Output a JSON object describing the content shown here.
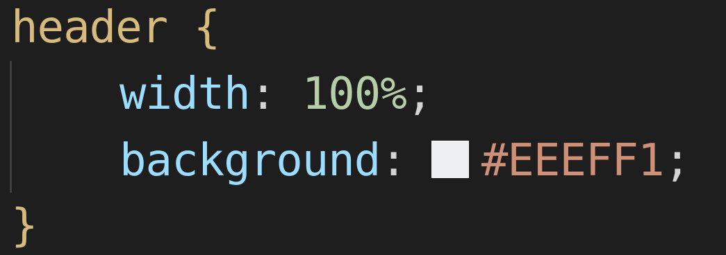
{
  "code": {
    "line1": {
      "selector": "header",
      "open_brace": "{"
    },
    "line2": {
      "property": "width",
      "colon": ":",
      "value": "100%",
      "semicolon": ";"
    },
    "line3": {
      "property": "background",
      "colon": ":",
      "value": "#EEEFF1",
      "semicolon": ";"
    },
    "line4": {
      "close_brace": "}"
    }
  },
  "colors": {
    "editor_background": "#1e1e1e",
    "selector": "#d7ba7d",
    "property": "#9cdcfe",
    "number": "#b5cea8",
    "string_value": "#ce9178",
    "swatch": "#EEEFF1"
  }
}
